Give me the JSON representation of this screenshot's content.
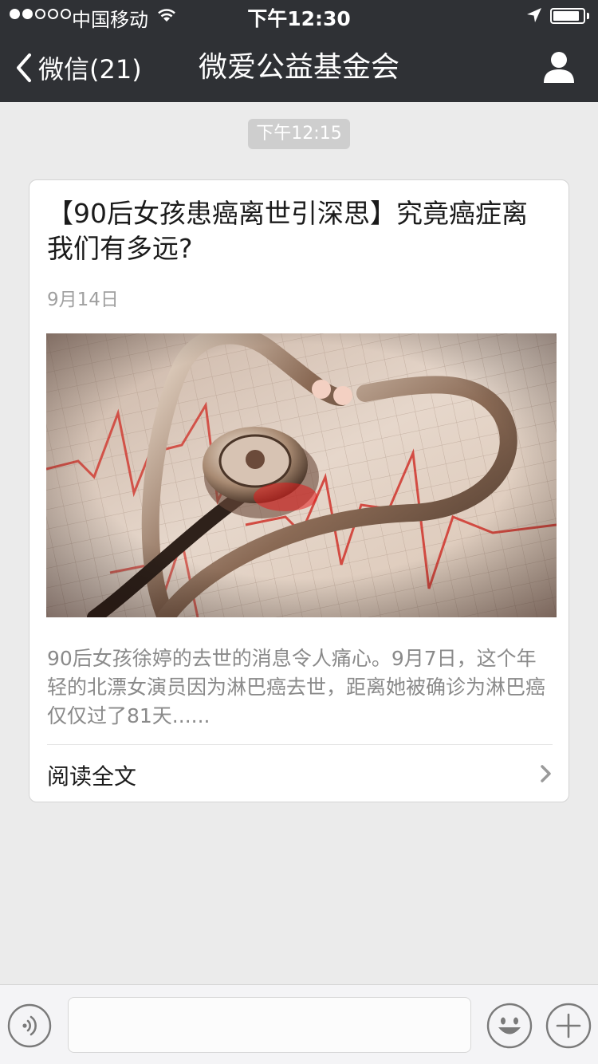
{
  "status_bar": {
    "carrier": "中国移动",
    "time": "下午12:30"
  },
  "nav": {
    "back_label": "微信(21)",
    "title": "微爱公益基金会"
  },
  "chat": {
    "timestamp": "下午12:15",
    "article": {
      "title": "【90后女孩患癌离世引深思】究竟癌症离我们有多远?",
      "date": "9月14日",
      "summary": "90后女孩徐婷的去世的消息令人痛心。9月7日，这个年轻的北漂女演员因为淋巴癌去世，距离她被确诊为淋巴癌仅仅过了81天......",
      "read_more": "阅读全文"
    }
  },
  "input_bar": {
    "value": "",
    "placeholder": ""
  },
  "icons": {
    "back": "chevron-left-icon",
    "profile": "user-icon",
    "voice": "voice-icon",
    "emoji": "emoji-icon",
    "add": "plus-icon",
    "read_more": "chevron-right-icon"
  },
  "colors": {
    "nav_background": "#2f3135",
    "page_background": "#ebebeb",
    "card_background": "#ffffff",
    "timestamp_pill": "#cecece"
  }
}
